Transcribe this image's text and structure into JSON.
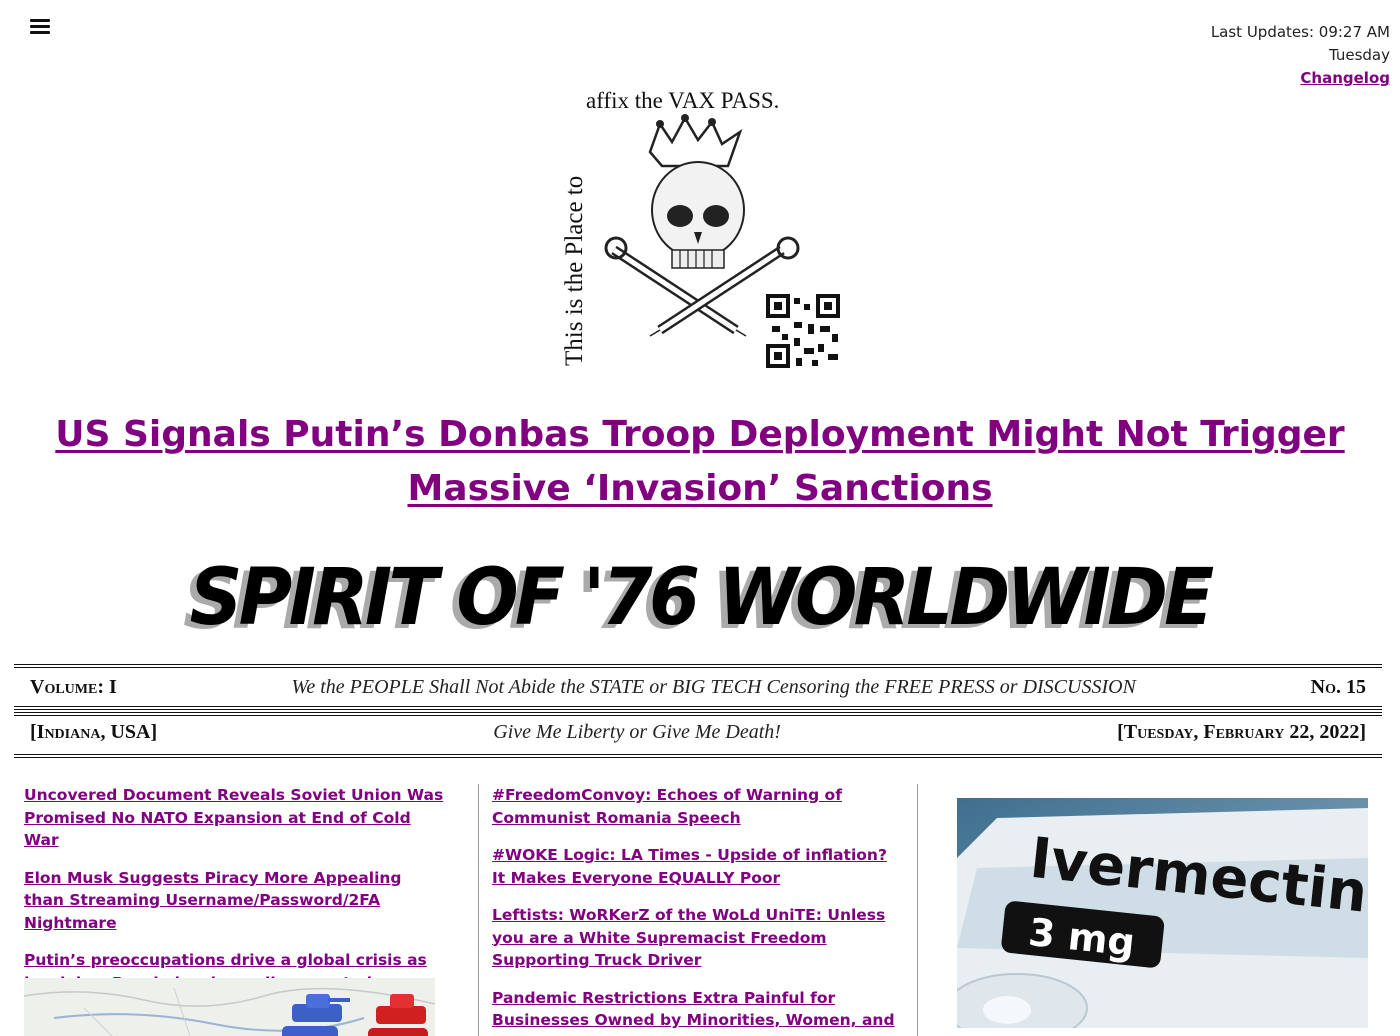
{
  "header": {
    "menu_icon": "hamburger-menu-icon",
    "last_updates": "Last Updates: 09:27 AM",
    "day": "Tuesday",
    "changelog_label": "Changelog"
  },
  "logo": {
    "top_text": "affix the VAX PASS.",
    "side_text": "This is the Place to"
  },
  "headline": "US Signals Putin’s Donbas Troop Deployment Might Not Trigger Massive ‘Invasion’ Sanctions",
  "masthead": "SPIRIT OF '76 WORLDWIDE",
  "bar1": {
    "volume": "Volume: I",
    "motto": "We the PEOPLE Shall Not Abide the STATE or BIG TECH Censoring the FREE PRESS or DISCUSSION",
    "number": "No. 15"
  },
  "bar2": {
    "location": "[Indiana, USA]",
    "motto": "Give Me Liberty or Give Me Death!",
    "date": "[Tuesday, February 22, 2022]"
  },
  "column1": {
    "stories": [
      "Uncovered Document Reveals Soviet Union Was Promised No NATO Expansion at End of Cold War",
      "Elon Musk Suggests Piracy More Appealing than Streaming Username/Password/2FA Nightmare",
      "Putin’s preoccupations drive a global crisis as he claims Russia has been disrespected"
    ]
  },
  "column2": {
    "stories": [
      "#FreedomConvoy: Echoes of Warning of Communist Romania Speech",
      "#WOKE Logic: LA Times - Upside of inflation? It Makes Everyone EQUALLY Poor",
      "Leftists: WoRKerZ of the WoLd UniTE: Unless you are a White Supremacist Freedom Supporting Truck Driver",
      "Pandemic Restrictions Extra Painful for Businesses Owned by Minorities, Women, and"
    ]
  },
  "column3": {
    "image_text": "Ivermectin",
    "image_dose": "3 mg"
  },
  "colors": {
    "link": "#800080",
    "text": "#111111"
  }
}
